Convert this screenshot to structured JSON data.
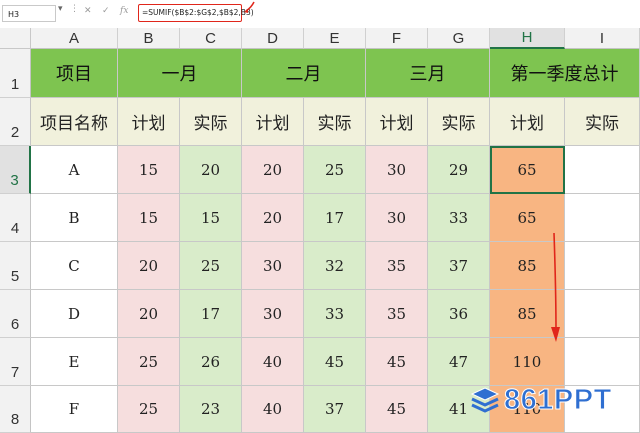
{
  "formula_bar": {
    "name_box": "H3",
    "formula": "=SUMIF($B$2:$G$2,$B$2,B3)",
    "icons": [
      "cancel-icon",
      "confirm-icon",
      "function-icon"
    ]
  },
  "column_headers": [
    "A",
    "B",
    "C",
    "D",
    "E",
    "F",
    "G",
    "H",
    "I"
  ],
  "row_headers": [
    "1",
    "2",
    "3",
    "4",
    "5",
    "6",
    "7",
    "8"
  ],
  "selected_cell": "H3",
  "header_row1": {
    "item": "项目",
    "jan": "一月",
    "feb": "二月",
    "mar": "三月",
    "q1_total": "第一季度总计"
  },
  "header_row2": [
    "项目名称",
    "计划",
    "实际",
    "计划",
    "实际",
    "计划",
    "实际",
    "计划",
    "实际"
  ],
  "rows": [
    {
      "name": "A",
      "values": [
        "15",
        "20",
        "20",
        "25",
        "30",
        "29"
      ],
      "total": "65"
    },
    {
      "name": "B",
      "values": [
        "15",
        "15",
        "20",
        "17",
        "30",
        "33"
      ],
      "total": "65"
    },
    {
      "name": "C",
      "values": [
        "20",
        "25",
        "30",
        "32",
        "35",
        "37"
      ],
      "total": "85"
    },
    {
      "name": "D",
      "values": [
        "20",
        "17",
        "30",
        "33",
        "35",
        "36"
      ],
      "total": "85"
    },
    {
      "name": "E",
      "values": [
        "25",
        "26",
        "40",
        "45",
        "45",
        "47"
      ],
      "total": "110"
    },
    {
      "name": "F",
      "values": [
        "25",
        "23",
        "40",
        "37",
        "45",
        "41"
      ],
      "total": "110"
    }
  ],
  "watermark": {
    "text": "861PPT",
    "icon": "stacked-layers-icon"
  },
  "colors": {
    "header_green": "#7ec450",
    "cream": "#f1f1dc",
    "plan_pink": "#f6dede",
    "actual_green": "#d9ecca",
    "total_orange": "#f8b582",
    "annotation_red": "#e0261b",
    "watermark_blue": "#2f6fd1"
  }
}
